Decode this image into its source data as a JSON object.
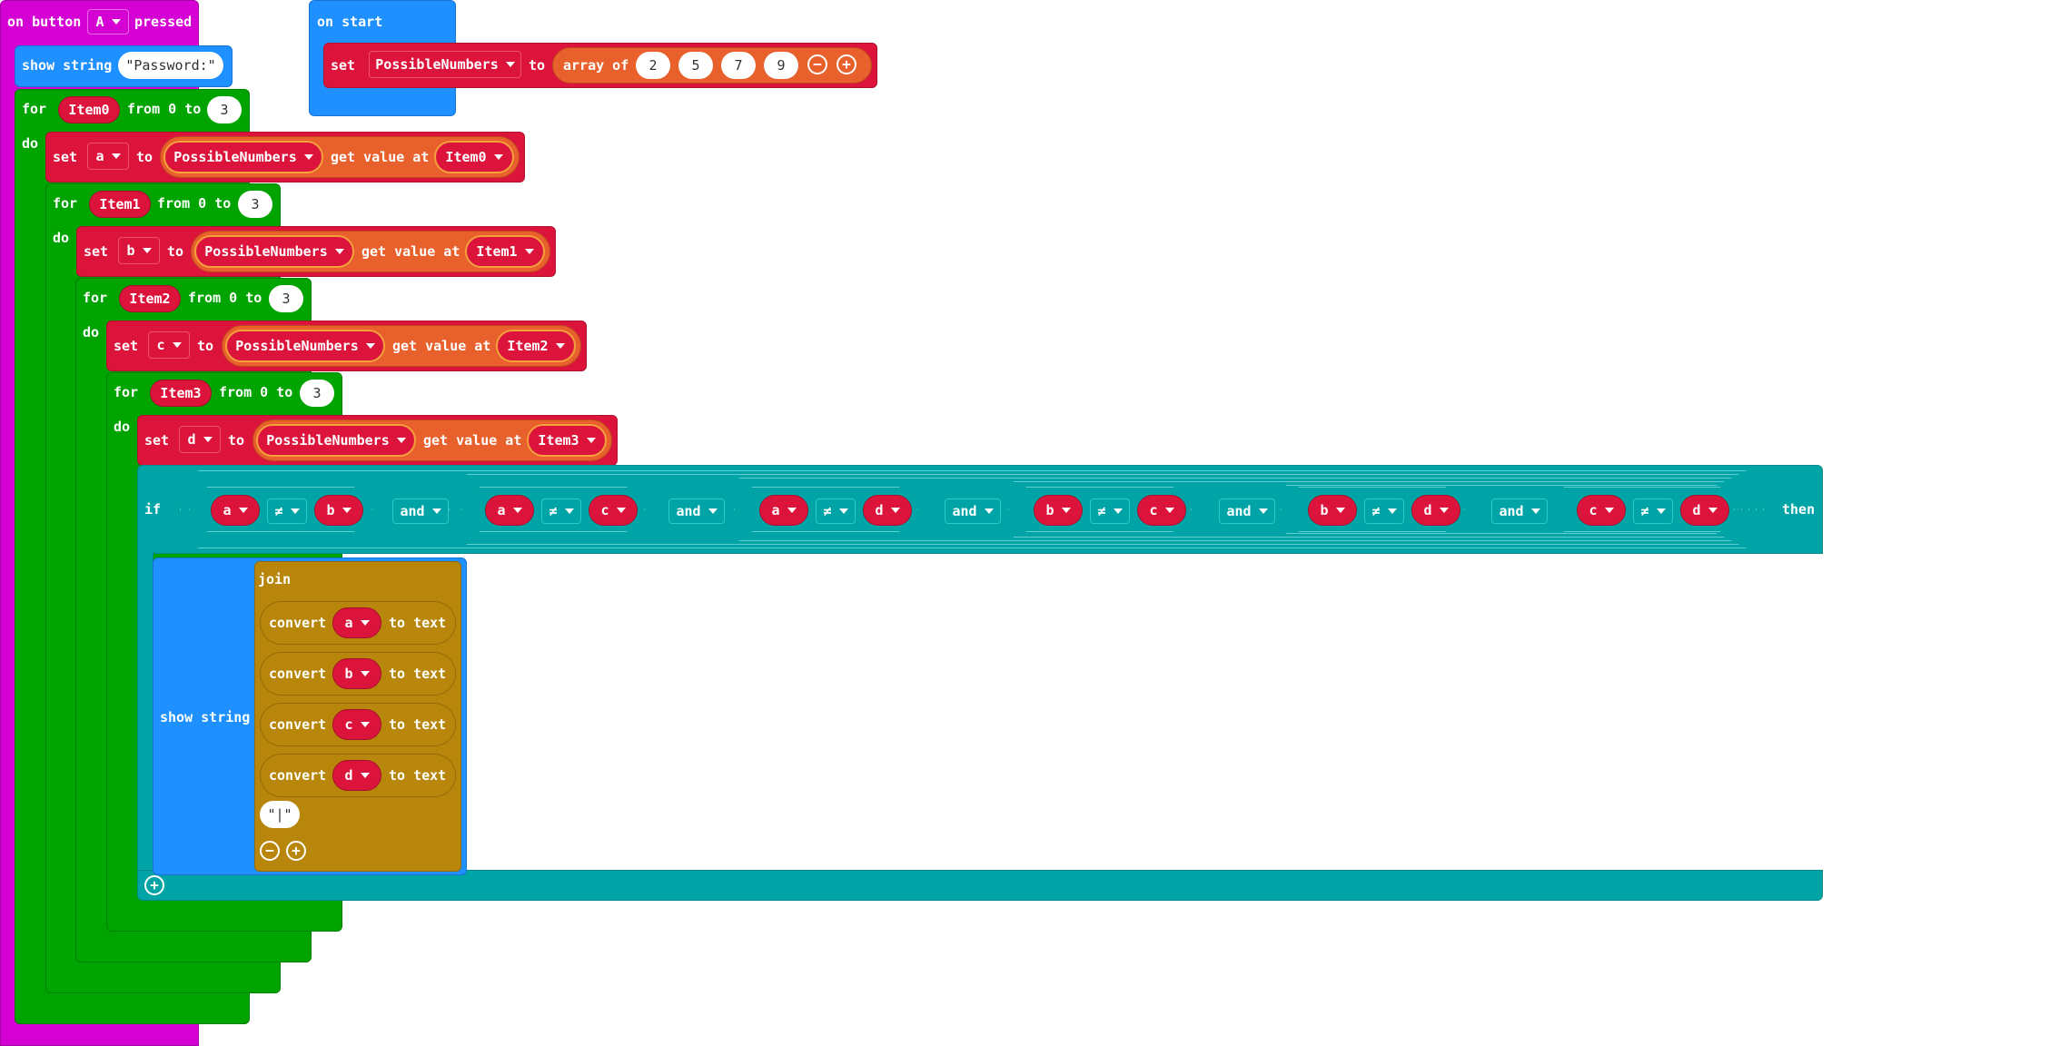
{
  "on_button": {
    "prefix": "on button",
    "button": "A",
    "suffix": "pressed"
  },
  "show_string_1": {
    "label": "show string",
    "value": "\"Password:\""
  },
  "loops": [
    {
      "for": "for",
      "var": "Item0",
      "from": "from 0 to",
      "to": "3",
      "do": "do"
    },
    {
      "for": "for",
      "var": "Item1",
      "from": "from 0 to",
      "to": "3",
      "do": "do"
    },
    {
      "for": "for",
      "var": "Item2",
      "from": "from 0 to",
      "to": "3",
      "do": "do"
    },
    {
      "for": "for",
      "var": "Item3",
      "from": "from 0 to",
      "to": "3",
      "do": "do"
    }
  ],
  "sets": [
    {
      "set": "set",
      "var": "a",
      "to": "to",
      "arr": "PossibleNumbers",
      "get": "get value at",
      "idx": "Item0"
    },
    {
      "set": "set",
      "var": "b",
      "to": "to",
      "arr": "PossibleNumbers",
      "get": "get value at",
      "idx": "Item1"
    },
    {
      "set": "set",
      "var": "c",
      "to": "to",
      "arr": "PossibleNumbers",
      "get": "get value at",
      "idx": "Item2"
    },
    {
      "set": "set",
      "var": "d",
      "to": "to",
      "arr": "PossibleNumbers",
      "get": "get value at",
      "idx": "Item3"
    }
  ],
  "if_block": {
    "if": "if",
    "then": "then",
    "conditions": [
      {
        "l": "a",
        "op": "≠",
        "r": "b"
      },
      {
        "l": "a",
        "op": "≠",
        "r": "c"
      },
      {
        "l": "a",
        "op": "≠",
        "r": "d"
      },
      {
        "l": "b",
        "op": "≠",
        "r": "c"
      },
      {
        "l": "b",
        "op": "≠",
        "r": "d"
      },
      {
        "l": "c",
        "op": "≠",
        "r": "d"
      }
    ],
    "and": "and"
  },
  "show_string_2": {
    "label": "show string"
  },
  "join": {
    "label": "join",
    "items": [
      {
        "convert": "convert",
        "var": "a",
        "to": "to text"
      },
      {
        "convert": "convert",
        "var": "b",
        "to": "to text"
      },
      {
        "convert": "convert",
        "var": "c",
        "to": "to text"
      },
      {
        "convert": "convert",
        "var": "d",
        "to": "to text"
      }
    ],
    "string": "\"|\""
  },
  "on_start": {
    "label": "on start",
    "set": "set",
    "var": "PossibleNumbers",
    "to": "to",
    "array_of": "array of",
    "values": [
      "2",
      "5",
      "7",
      "9"
    ]
  },
  "colors": {
    "event": "#d400d4",
    "basic": "#1e90ff",
    "loops": "#00a400",
    "variables": "#dc143c",
    "logic": "#00a4a6",
    "text": "#b8860b",
    "arrays": "#e8602c"
  }
}
